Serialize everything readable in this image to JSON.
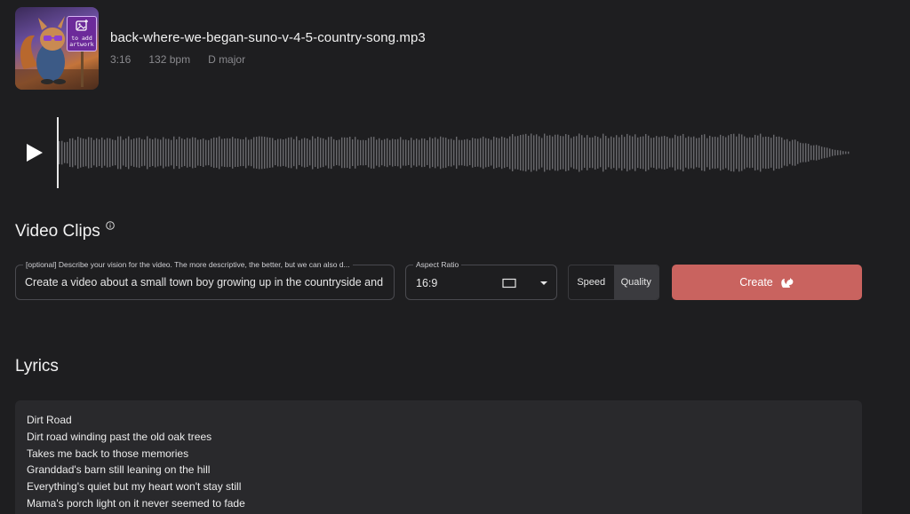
{
  "track": {
    "title": "back-where-we-began-suno-v-4-5-country-song.mp3",
    "duration": "3:16",
    "bpm": "132 bpm",
    "key": "D major",
    "artwork_badge": "to add\nartwork"
  },
  "player": {
    "play_icon": "play-icon"
  },
  "video_clips": {
    "title": "Video Clips",
    "vision_label": "[optional] Describe your vision for the video. The more descriptive, the better, but we can also d...",
    "vision_value": "Create a video about a small town boy growing up in the countryside and",
    "aspect_label": "Aspect Ratio",
    "aspect_value": "16:9",
    "mode_options": [
      "Speed",
      "Quality"
    ],
    "selected_mode": "Quality",
    "create_label": "Create"
  },
  "lyrics": {
    "title": "Lyrics",
    "lines": [
      "Dirt Road",
      "Dirt road winding past the old oak trees",
      "Takes me back to those memories",
      "Granddad's barn still leaning on the hill",
      "Everything's quiet but my heart won't stay still",
      "Mama's porch light on it never seemed to fade"
    ]
  },
  "colors": {
    "background": "#1e1e20",
    "accent": "#c9635f",
    "waveform": "#6a6a6e"
  }
}
